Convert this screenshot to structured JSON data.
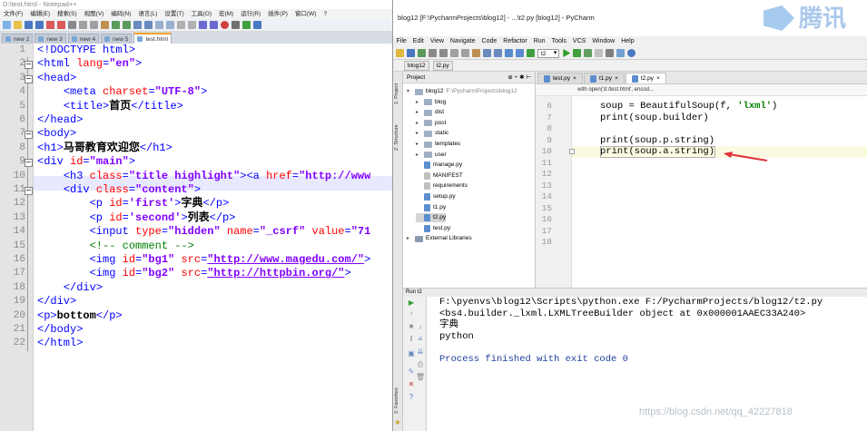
{
  "notepad": {
    "title": "D:\\test.html - Notepad++",
    "menu": [
      "文件(F)",
      "编辑(E)",
      "搜索(S)",
      "视图(V)",
      "编码(N)",
      "语言(L)",
      "设置(T)",
      "工具(O)",
      "宏(M)",
      "运行(R)",
      "插件(P)",
      "窗口(W)",
      "?"
    ],
    "tabs": [
      "new 2",
      "new 3",
      "new 4",
      "new 5",
      "test.html"
    ],
    "line_numbers": [
      "1",
      "2",
      "3",
      "4",
      "5",
      "6",
      "7",
      "8",
      "9",
      "10",
      "11",
      "12",
      "13",
      "14",
      "15",
      "16",
      "17",
      "18",
      "19",
      "20",
      "21",
      "22"
    ]
  },
  "pycharm": {
    "title": "blog12 [F:\\PycharmProjects\\blog12] - ...\\t2.py [blog12] - PyCharm",
    "menu": [
      "File",
      "Edit",
      "View",
      "Navigate",
      "Code",
      "Refactor",
      "Run",
      "Tools",
      "VCS",
      "Window",
      "Help"
    ],
    "run_config": "t2",
    "breadcrumb": [
      "blog12",
      "t2.py"
    ],
    "project_header": "Project",
    "tree": [
      {
        "label": "blog12",
        "suffix": "F:\\PycharmProjects\\blog12",
        "kind": "root"
      },
      {
        "label": "blog",
        "kind": "folder"
      },
      {
        "label": "dist",
        "kind": "folder"
      },
      {
        "label": "post",
        "kind": "folder"
      },
      {
        "label": "static",
        "kind": "folder"
      },
      {
        "label": "templates",
        "kind": "folder"
      },
      {
        "label": "user",
        "kind": "folder"
      },
      {
        "label": "manage.py",
        "kind": "file"
      },
      {
        "label": "MANIFEST",
        "kind": "txt"
      },
      {
        "label": "requirements",
        "kind": "txt"
      },
      {
        "label": "setup.py",
        "kind": "file"
      },
      {
        "label": "t1.py",
        "kind": "file"
      },
      {
        "label": "t2.py",
        "kind": "file",
        "selected": true
      },
      {
        "label": "test.py",
        "kind": "file"
      },
      {
        "label": "External Libraries",
        "kind": "lib"
      }
    ],
    "editor_tabs": [
      "test.py",
      "t1.py",
      "t2.py"
    ],
    "hint": "with open('d:/test.html', encod...",
    "editor_line_numbers": [
      "6",
      "7",
      "8",
      "9",
      "10",
      "11",
      "12",
      "13",
      "14",
      "15",
      "16",
      "17",
      "18"
    ],
    "editor_code": [
      "soup = BeautifulSoup(f, 'lxml')",
      "print(soup.builder)",
      "",
      "print(soup.p.string)",
      "print(soup.a.string)"
    ],
    "run_tab": "Run  t2",
    "output": [
      "F:\\pyenvs\\blog12\\Scripts\\python.exe F:/PycharmProjects/blog12/t2.py",
      "<bs4.builder._lxml.LXMLTreeBuilder object at 0x000001AAEC33A240>",
      "字典",
      "python",
      "",
      "Process finished with exit code 0"
    ],
    "side_tabs": [
      "1: Project",
      "Z: Structure",
      "2: Favorites"
    ]
  },
  "tencent_logo": "腾讯",
  "watermark": "https://blog.csdn.net/qq_42227818",
  "colors": {
    "npp_tag": "#0000ff",
    "npp_attr": "#ff0000",
    "npp_string": "#8000ff",
    "npp_comment": "#008000",
    "arrow": "#e0303a"
  }
}
